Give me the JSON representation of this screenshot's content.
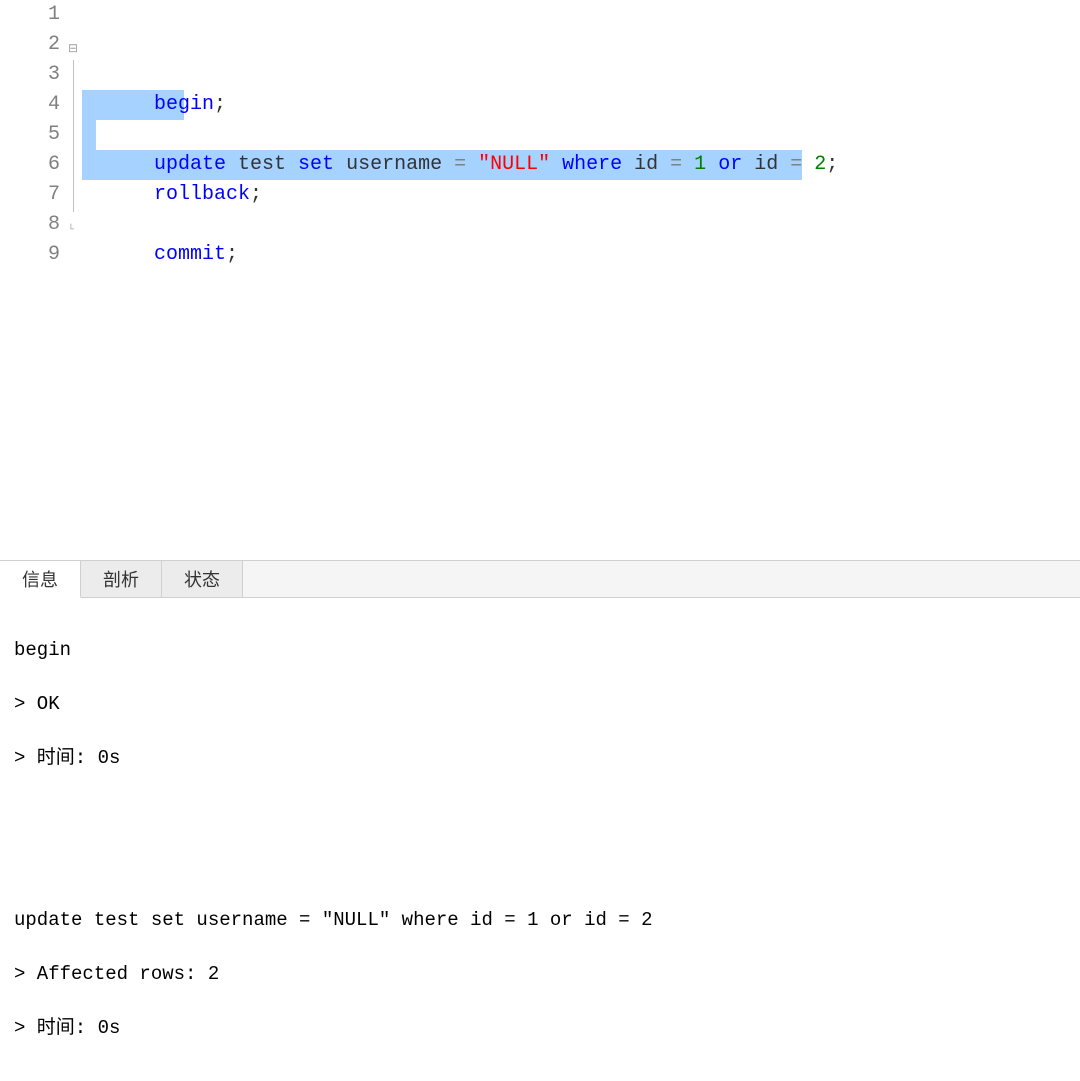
{
  "editor": {
    "line_numbers": [
      "1",
      "2",
      "3",
      "4",
      "5",
      "6",
      "7",
      "8",
      "9"
    ],
    "tokens": {
      "l2": {
        "begin": "begin",
        "semi": ";"
      },
      "l4": {
        "update": "update",
        "test": " test ",
        "set": "set",
        "username": " username ",
        "eq": "= ",
        "str": "\"NULL\"",
        "where": " where",
        "id1": " id ",
        "eq2": "= ",
        "n1": "1",
        "or": " or",
        "id2": " id ",
        "eq3": "= ",
        "n2": "2",
        "semi": ";"
      },
      "l6": {
        "rollback": "rollback",
        "semi": ";"
      },
      "l8": {
        "commit": "commit",
        "semi": ";"
      }
    }
  },
  "tabs": {
    "info": "信息",
    "profiling": "剖析",
    "status": "状态",
    "active": "info"
  },
  "output": {
    "block1_cmd": "begin",
    "block1_res1": "> OK",
    "block1_res2": "> 时间: 0s",
    "block2_cmd": "update test set username = \"NULL\" where id = 1 or id = 2",
    "block2_res1": "> Affected rows: 2",
    "block2_res2": "> 时间: 0s"
  }
}
